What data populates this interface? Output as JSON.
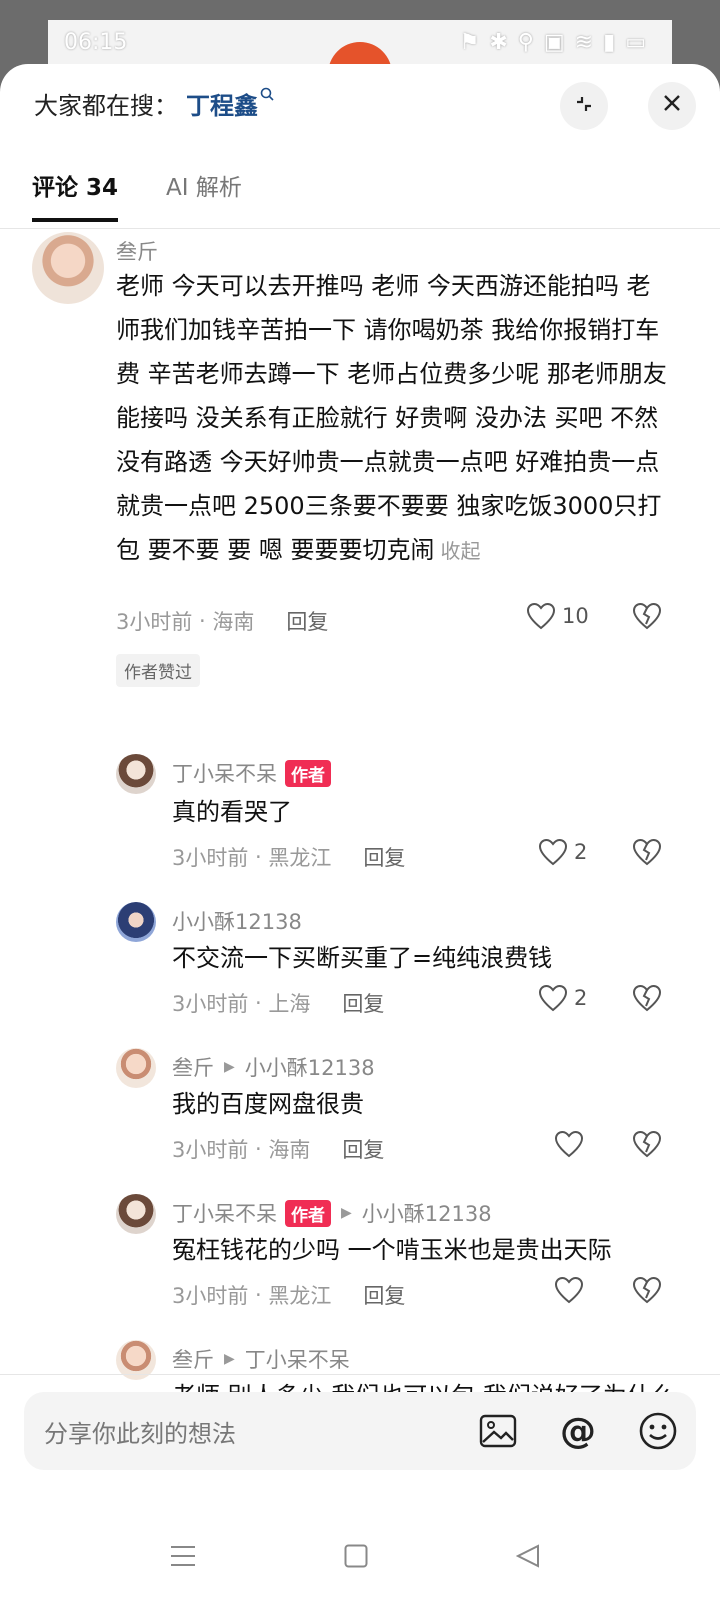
{
  "statusbar": {
    "time": "06:15"
  },
  "header": {
    "search_prefix": "大家都在搜：",
    "search_keyword": "丁程鑫"
  },
  "tabs": [
    {
      "label": "评论 34"
    },
    {
      "label": "AI 解析"
    }
  ],
  "comments": {
    "main": {
      "nickname": "叁斤",
      "text": "老师 今天可以去开推吗 老师 今天西游还能拍吗 老师我们加钱辛苦拍一下 请你喝奶茶 我给你报销打车费 辛苦老师去蹲一下 老师占位费多少呢 那老师朋友能接吗 没关系有正脸就行 好贵啊 没办法 买吧 不然没有路透 今天好帅贵一点就贵一点吧 好难拍贵一点就贵一点吧 2500三条要不要要 独家吃饭3000只打包 要不要 要  嗯 要要要切克闹",
      "fold_label": "收起",
      "time": "3小时前",
      "location": "海南",
      "reply_label": "回复",
      "likes": "10",
      "liked_tag": "作者赞过"
    },
    "replies": [
      {
        "nickname": "丁小呆不呆",
        "badge": "作者",
        "reply_to": "",
        "text": "真的看哭了",
        "time": "3小时前",
        "location": "黑龙江",
        "reply_label": "回复",
        "likes": "2"
      },
      {
        "nickname": "小小酥12138",
        "badge": "",
        "reply_to": "",
        "text": "不交流一下买断买重了=纯纯浪费钱",
        "time": "3小时前",
        "location": "上海",
        "reply_label": "回复",
        "likes": "2"
      },
      {
        "nickname": "叁斤",
        "badge": "",
        "reply_to": "小小酥12138",
        "text": "我的百度网盘很贵",
        "time": "3小时前",
        "location": "海南",
        "reply_label": "回复",
        "likes": ""
      },
      {
        "nickname": "丁小呆不呆",
        "badge": "作者",
        "reply_to": "小小酥12138",
        "text": "冤枉钱花的少吗 一个啃玉米也是贵出天际",
        "time": "3小时前",
        "location": "黑龙江",
        "reply_label": "回复",
        "likes": ""
      },
      {
        "nickname": "叁斤",
        "badge": "",
        "reply_to": "丁小呆不呆",
        "text": "老师 别人多少 我们也可以包 我们说好了为什么说跑就跑"
      }
    ]
  },
  "input": {
    "placeholder": "分享你此刻的想法"
  },
  "icons": {
    "search": "search-icon",
    "collapse": "collapse-icon",
    "close": "close-icon",
    "like": "heart-icon",
    "dislike": "broken-heart-icon",
    "image": "image-icon",
    "mention": "at-icon",
    "emoji": "emoji-icon"
  },
  "colors": {
    "author_badge": "#f02d54",
    "keyword": "#1d4d88"
  }
}
